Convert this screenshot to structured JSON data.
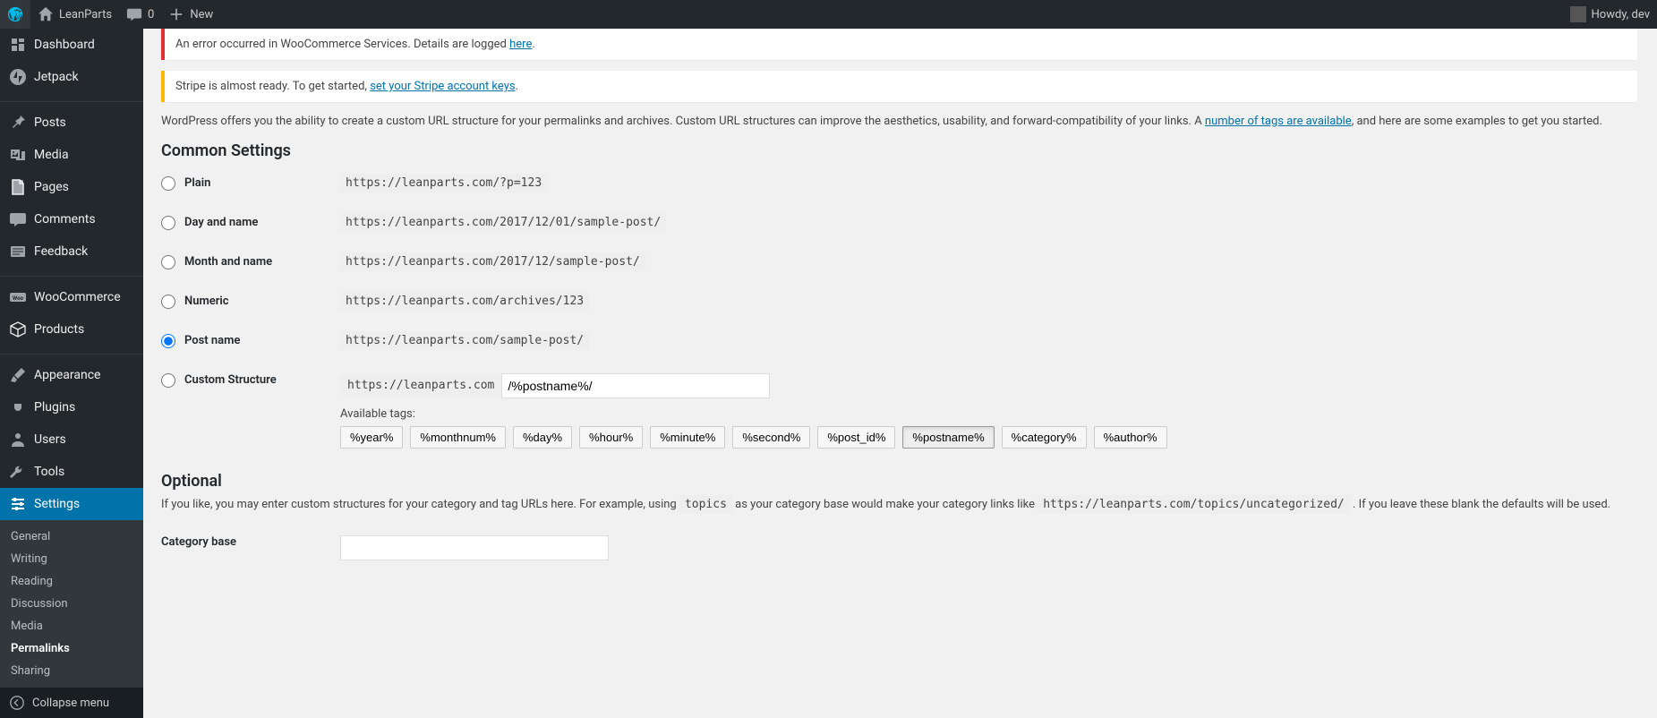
{
  "topbar": {
    "site_name": "LeanParts",
    "comments": "0",
    "new_label": "New",
    "howdy": "Howdy, dev"
  },
  "sidebar": {
    "items": [
      {
        "label": "Dashboard",
        "icon": "dashboard"
      },
      {
        "label": "Jetpack",
        "icon": "jetpack"
      },
      {
        "sep": true
      },
      {
        "label": "Posts",
        "icon": "pin"
      },
      {
        "label": "Media",
        "icon": "media"
      },
      {
        "label": "Pages",
        "icon": "pages"
      },
      {
        "label": "Comments",
        "icon": "comment"
      },
      {
        "label": "Feedback",
        "icon": "feedback"
      },
      {
        "sep": true
      },
      {
        "label": "WooCommerce",
        "icon": "woo"
      },
      {
        "label": "Products",
        "icon": "box"
      },
      {
        "sep": true
      },
      {
        "label": "Appearance",
        "icon": "brush"
      },
      {
        "label": "Plugins",
        "icon": "plug"
      },
      {
        "label": "Users",
        "icon": "user"
      },
      {
        "label": "Tools",
        "icon": "wrench"
      },
      {
        "label": "Settings",
        "icon": "sliders",
        "current": true
      }
    ],
    "submenu": [
      "General",
      "Writing",
      "Reading",
      "Discussion",
      "Media",
      "Permalinks",
      "Sharing"
    ],
    "submenu_active": "Permalinks",
    "collapse": "Collapse menu"
  },
  "notices": {
    "woo_error": "An error occurred in WooCommerce Services. Details are logged ",
    "woo_error_link": "here",
    "stripe": "Stripe is almost ready. To get started, ",
    "stripe_link": "set your Stripe account keys"
  },
  "intro": {
    "text1": "WordPress offers you the ability to create a custom URL structure for your permalinks and archives. Custom URL structures can improve the aesthetics, usability, and forward-compatibility of your links. A ",
    "link": "number of tags are available",
    "text2": ", and here are some examples to get you started."
  },
  "headings": {
    "common": "Common Settings",
    "optional": "Optional"
  },
  "options": [
    {
      "id": "plain",
      "label": "Plain",
      "example": "https://leanparts.com/?p=123",
      "selected": false
    },
    {
      "id": "dayname",
      "label": "Day and name",
      "example": "https://leanparts.com/2017/12/01/sample-post/",
      "selected": false
    },
    {
      "id": "monthname",
      "label": "Month and name",
      "example": "https://leanparts.com/2017/12/sample-post/",
      "selected": false
    },
    {
      "id": "numeric",
      "label": "Numeric",
      "example": "https://leanparts.com/archives/123",
      "selected": false
    },
    {
      "id": "postname",
      "label": "Post name",
      "example": "https://leanparts.com/sample-post/",
      "selected": true
    },
    {
      "id": "custom",
      "label": "Custom Structure",
      "prefix": "https://leanparts.com",
      "value": "/%postname%/",
      "selected": false
    }
  ],
  "tags": {
    "label": "Available tags:",
    "items": [
      "%year%",
      "%monthnum%",
      "%day%",
      "%hour%",
      "%minute%",
      "%second%",
      "%post_id%",
      "%postname%",
      "%category%",
      "%author%"
    ],
    "active": "%postname%"
  },
  "optional": {
    "text1": "If you like, you may enter custom structures for your category and tag URLs here. For example, using ",
    "code1": "topics",
    "text2": " as your category base would make your category links like ",
    "code2": "https://leanparts.com/topics/uncategorized/",
    "text3": " . If you leave these blank the defaults will be used."
  },
  "category_base": {
    "label": "Category base",
    "value": ""
  }
}
